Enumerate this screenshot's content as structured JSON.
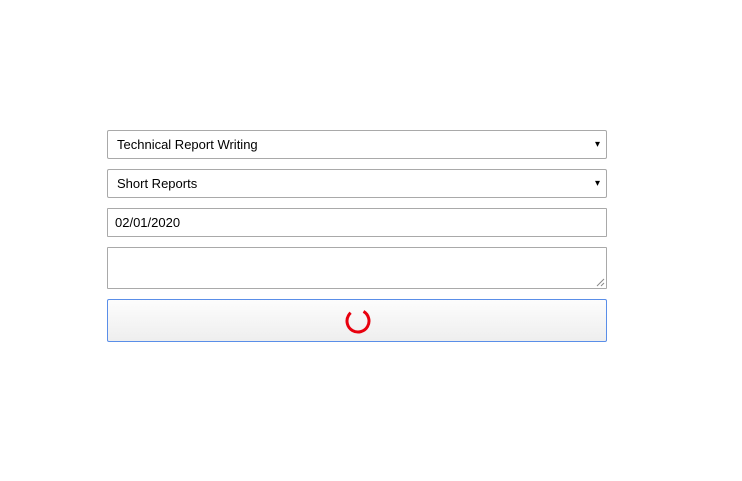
{
  "form": {
    "course_select": {
      "value": "Technical Report Writing",
      "arrow": "▾"
    },
    "type_select": {
      "value": "Short Reports",
      "arrow": "▾"
    },
    "date_input": {
      "value": "02/01/2020"
    },
    "notes_textarea": {
      "value": ""
    },
    "submit_button": {
      "state": "loading",
      "spinner_icon": "loading-spinner-icon",
      "spinner_color": "#e8000e"
    }
  },
  "colors": {
    "input_border": "#a9a9a9",
    "focus_border": "#5a8ee8",
    "spinner": "#e8000e"
  }
}
